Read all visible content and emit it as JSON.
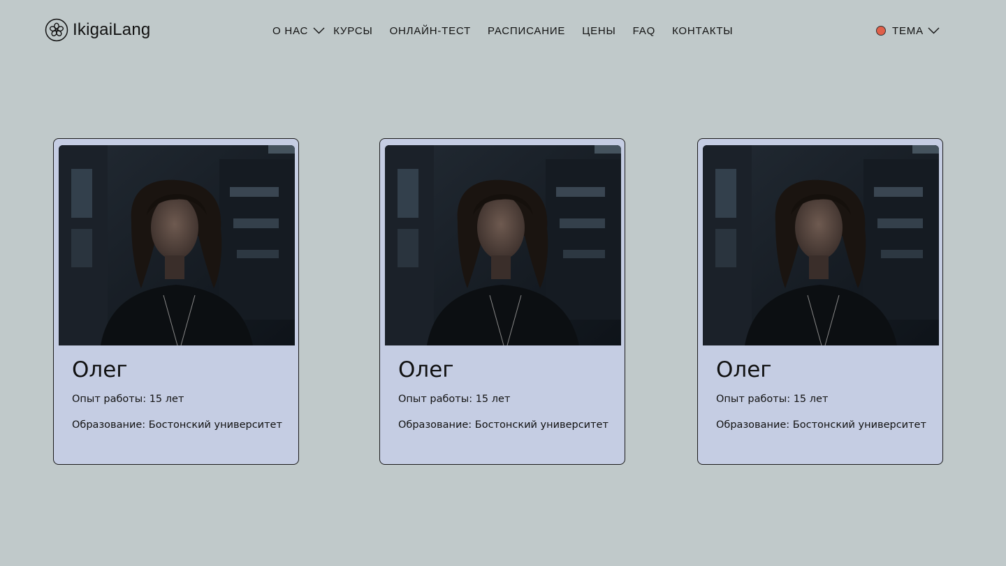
{
  "brand": {
    "name": "IkigaiLang",
    "icon": "flower-logo-icon"
  },
  "nav": {
    "items": [
      {
        "label": "О НАС",
        "has_dropdown": true
      },
      {
        "label": "КУРСЫ"
      },
      {
        "label": "ОНЛАЙН-ТЕСТ"
      },
      {
        "label": "РАСПИСАНИЕ"
      },
      {
        "label": "ЦЕНЫ"
      },
      {
        "label": "FAQ"
      },
      {
        "label": "КОНТАКТЫ"
      }
    ]
  },
  "theme": {
    "label": "ТЕМА",
    "dot_color": "#e0604a",
    "icon": "chevron-down-icon"
  },
  "colors": {
    "background": "#c0c9ca",
    "card_background": "#c5cde3",
    "card_border": "#1a1a1a"
  },
  "teachers": [
    {
      "name": "Олег",
      "experience": "Опыт работы: 15 лет",
      "education": "Образование: Бостонский университет"
    },
    {
      "name": "Олег",
      "experience": "Опыт работы: 15 лет",
      "education": "Образование: Бостонский университет"
    },
    {
      "name": "Олег",
      "experience": "Опыт работы: 15 лет",
      "education": "Образование: Бостонский университет"
    }
  ]
}
